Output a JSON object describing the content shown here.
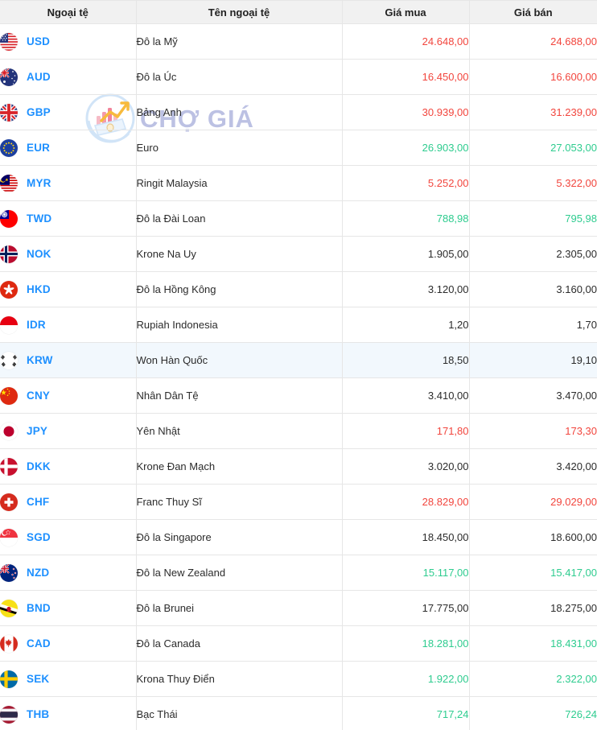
{
  "table": {
    "columns": [
      {
        "key": "code",
        "label": "Ngoại tệ"
      },
      {
        "key": "name",
        "label": "Tên ngoại tệ"
      },
      {
        "key": "buy",
        "label": "Giá mua"
      },
      {
        "key": "sell",
        "label": "Giá bán"
      }
    ],
    "rows": [
      {
        "code": "USD",
        "flag": "flag-us",
        "name": "Đô la Mỹ",
        "buy": "24.648,00",
        "sell": "24.688,00",
        "buy_state": "up",
        "sell_state": "up",
        "highlighted": false
      },
      {
        "code": "AUD",
        "flag": "flag-au",
        "name": "Đô la Úc",
        "buy": "16.450,00",
        "sell": "16.600,00",
        "buy_state": "up",
        "sell_state": "up",
        "highlighted": false
      },
      {
        "code": "GBP",
        "flag": "flag-gb",
        "name": "Bảng Anh",
        "buy": "30.939,00",
        "sell": "31.239,00",
        "buy_state": "up",
        "sell_state": "up",
        "highlighted": false
      },
      {
        "code": "EUR",
        "flag": "flag-eu",
        "name": "Euro",
        "buy": "26.903,00",
        "sell": "27.053,00",
        "buy_state": "down",
        "sell_state": "down",
        "highlighted": false
      },
      {
        "code": "MYR",
        "flag": "flag-my",
        "name": "Ringit Malaysia",
        "buy": "5.252,00",
        "sell": "5.322,00",
        "buy_state": "up",
        "sell_state": "up",
        "highlighted": false
      },
      {
        "code": "TWD",
        "flag": "flag-tw",
        "name": "Đô la Đài Loan",
        "buy": "788,98",
        "sell": "795,98",
        "buy_state": "down",
        "sell_state": "down",
        "highlighted": false
      },
      {
        "code": "NOK",
        "flag": "flag-no",
        "name": "Krone Na Uy",
        "buy": "1.905,00",
        "sell": "2.305,00",
        "buy_state": "flat",
        "sell_state": "flat",
        "highlighted": false
      },
      {
        "code": "HKD",
        "flag": "flag-hk",
        "name": "Đô la Hồng Kông",
        "buy": "3.120,00",
        "sell": "3.160,00",
        "buy_state": "flat",
        "sell_state": "flat",
        "highlighted": false
      },
      {
        "code": "IDR",
        "flag": "flag-id",
        "name": "Rupiah Indonesia",
        "buy": "1,20",
        "sell": "1,70",
        "buy_state": "flat",
        "sell_state": "flat",
        "highlighted": false
      },
      {
        "code": "KRW",
        "flag": "flag-kr",
        "name": "Won Hàn Quốc",
        "buy": "18,50",
        "sell": "19,10",
        "buy_state": "flat",
        "sell_state": "flat",
        "highlighted": true
      },
      {
        "code": "CNY",
        "flag": "flag-cn",
        "name": "Nhân Dân Tệ",
        "buy": "3.410,00",
        "sell": "3.470,00",
        "buy_state": "flat",
        "sell_state": "flat",
        "highlighted": false
      },
      {
        "code": "JPY",
        "flag": "flag-jp",
        "name": "Yên Nhật",
        "buy": "171,80",
        "sell": "173,30",
        "buy_state": "up",
        "sell_state": "up",
        "highlighted": false
      },
      {
        "code": "DKK",
        "flag": "flag-dk",
        "name": "Krone Đan Mạch",
        "buy": "3.020,00",
        "sell": "3.420,00",
        "buy_state": "flat",
        "sell_state": "flat",
        "highlighted": false
      },
      {
        "code": "CHF",
        "flag": "flag-ch",
        "name": "Franc Thuy Sĩ",
        "buy": "28.829,00",
        "sell": "29.029,00",
        "buy_state": "up",
        "sell_state": "up",
        "highlighted": false
      },
      {
        "code": "SGD",
        "flag": "flag-sg",
        "name": "Đô la Singapore",
        "buy": "18.450,00",
        "sell": "18.600,00",
        "buy_state": "flat",
        "sell_state": "flat",
        "highlighted": false
      },
      {
        "code": "NZD",
        "flag": "flag-nz",
        "name": "Đô la New Zealand",
        "buy": "15.117,00",
        "sell": "15.417,00",
        "buy_state": "down",
        "sell_state": "down",
        "highlighted": false
      },
      {
        "code": "BND",
        "flag": "flag-bn",
        "name": "Đô la Brunei",
        "buy": "17.775,00",
        "sell": "18.275,00",
        "buy_state": "flat",
        "sell_state": "flat",
        "highlighted": false
      },
      {
        "code": "CAD",
        "flag": "flag-ca",
        "name": "Đô la Canada",
        "buy": "18.281,00",
        "sell": "18.431,00",
        "buy_state": "down",
        "sell_state": "down",
        "highlighted": false
      },
      {
        "code": "SEK",
        "flag": "flag-se",
        "name": "Krona Thuy Điển",
        "buy": "1.922,00",
        "sell": "2.322,00",
        "buy_state": "down",
        "sell_state": "down",
        "highlighted": false
      },
      {
        "code": "THB",
        "flag": "flag-th",
        "name": "Bạc Thái",
        "buy": "717,24",
        "sell": "726,24",
        "buy_state": "down",
        "sell_state": "down",
        "highlighted": false
      }
    ]
  },
  "watermark": {
    "text": "CHỢ GIÁ",
    "logo_icon": "chart-money-logo-icon"
  },
  "colors": {
    "up": "#f2453d",
    "down": "#2ecc8f",
    "flat": "#2b2b2b",
    "code": "#1e90ff",
    "header_bg": "#f1f1f1",
    "row_highlight": "#f2f8fd"
  }
}
